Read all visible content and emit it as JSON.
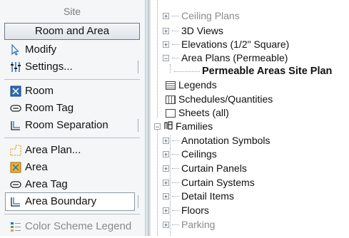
{
  "left_panel": {
    "site_label": "Site",
    "section_title": "Room and Area",
    "tools": [
      {
        "label": "Modify"
      },
      {
        "label": "Settings..."
      },
      {
        "label": "Room"
      },
      {
        "label": "Room Tag"
      },
      {
        "label": "Room Separation"
      },
      {
        "label": "Area Plan..."
      },
      {
        "label": "Area"
      },
      {
        "label": "Area Tag"
      },
      {
        "label": "Area Boundary"
      },
      {
        "label": "Color Scheme Legend"
      }
    ]
  },
  "tree": {
    "items": [
      {
        "label": "Ceiling Plans"
      },
      {
        "label": "3D Views"
      },
      {
        "label": "Elevations (1/2\" Square)"
      },
      {
        "label": "Area Plans (Permeable)"
      },
      {
        "label": "Permeable Areas Site Plan"
      },
      {
        "label": "Legends"
      },
      {
        "label": "Schedules/Quantities"
      },
      {
        "label": "Sheets (all)"
      },
      {
        "label": "Families"
      },
      {
        "label": "Annotation Symbols"
      },
      {
        "label": "Ceilings"
      },
      {
        "label": "Curtain Panels"
      },
      {
        "label": "Curtain Systems"
      },
      {
        "label": "Detail Items"
      },
      {
        "label": "Floors"
      },
      {
        "label": "Parking"
      }
    ]
  },
  "colors": {
    "accent_blue": "#2c6fb7",
    "panel_bg": "#f4f6f8",
    "area_orange": "#e8a21a"
  }
}
